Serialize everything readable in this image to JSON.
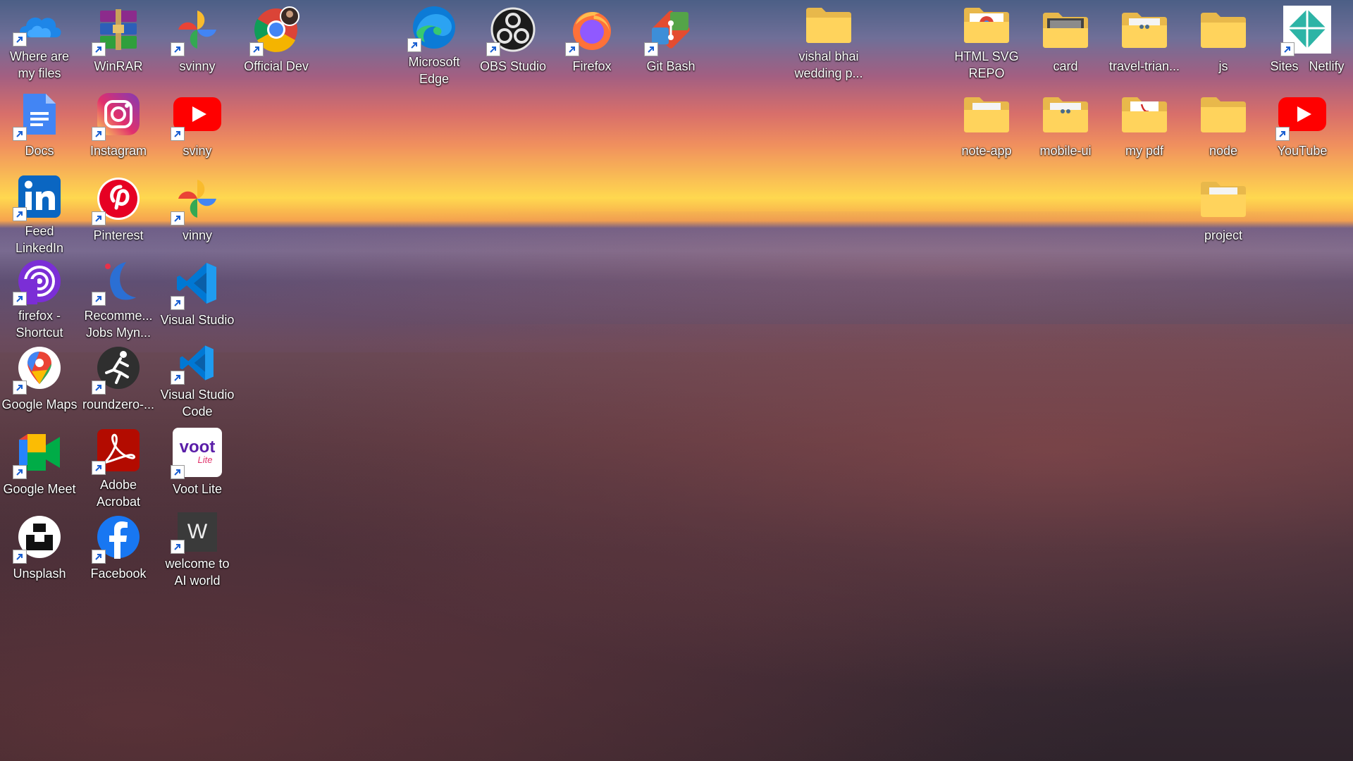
{
  "desktop": {
    "icons": [
      {
        "label": "Where are my files",
        "icon": "onedrive-cloud-icon"
      },
      {
        "label": "WinRAR",
        "icon": "winrar-icon"
      },
      {
        "label": "svinny",
        "icon": "google-photos-icon"
      },
      {
        "label": "Official Dev",
        "icon": "chrome-profile-icon"
      },
      {
        "label": "Microsoft Edge",
        "icon": "edge-icon"
      },
      {
        "label": "OBS Studio",
        "icon": "obs-icon"
      },
      {
        "label": "Firefox",
        "icon": "firefox-icon"
      },
      {
        "label": "Git Bash",
        "icon": "git-icon"
      },
      {
        "label": "vishal bhai wedding p...",
        "icon": "folder-icon"
      },
      {
        "label": "HTML SVG REPO",
        "icon": "folder-chrome-icon"
      },
      {
        "label": "card",
        "icon": "folder-image-icon"
      },
      {
        "label": "travel-trian...",
        "icon": "folder-people-icon"
      },
      {
        "label": "js",
        "icon": "folder-icon"
      },
      {
        "label": "Sites",
        "icon": "netlify-icon"
      },
      {
        "label": "Netlify",
        "icon": "netlify-label"
      },
      {
        "label": "Docs",
        "icon": "google-docs-icon"
      },
      {
        "label": "Instagram",
        "icon": "instagram-icon"
      },
      {
        "label": "sviny",
        "icon": "youtube-icon"
      },
      {
        "label": "note-app",
        "icon": "folder-doc-icon"
      },
      {
        "label": "mobile-ui",
        "icon": "folder-people-icon"
      },
      {
        "label": "my pdf",
        "icon": "folder-pdf-icon"
      },
      {
        "label": "node",
        "icon": "folder-icon"
      },
      {
        "label": "YouTube",
        "icon": "youtube-icon"
      },
      {
        "label": "Feed LinkedIn",
        "icon": "linkedin-icon"
      },
      {
        "label": "Pinterest",
        "icon": "pinterest-icon"
      },
      {
        "label": "vinny",
        "icon": "google-photos-icon"
      },
      {
        "label": "project",
        "icon": "folder-doc-icon"
      },
      {
        "label": "firefox - Shortcut",
        "icon": "firefox-podcast-icon"
      },
      {
        "label": "Recomme... Jobs Myn...",
        "icon": "myntra-icon"
      },
      {
        "label": "Visual Studio",
        "icon": "vscode-icon"
      },
      {
        "label": "Google Maps",
        "icon": "google-maps-icon"
      },
      {
        "label": "roundzero-...",
        "icon": "runner-icon"
      },
      {
        "label": "Visual Studio Code",
        "icon": "vscode-icon"
      },
      {
        "label": "Google Meet",
        "icon": "google-meet-icon"
      },
      {
        "label": "Adobe Acrobat",
        "icon": "acrobat-icon"
      },
      {
        "label": "Voot Lite",
        "icon": "voot-icon"
      },
      {
        "label": "Unsplash",
        "icon": "unsplash-icon"
      },
      {
        "label": "Facebook",
        "icon": "facebook-icon"
      },
      {
        "label": "welcome to AI world",
        "icon": "w-letter-icon"
      }
    ],
    "voot_text": "voot",
    "voot_sub": "Lite",
    "w_letter": "W"
  }
}
